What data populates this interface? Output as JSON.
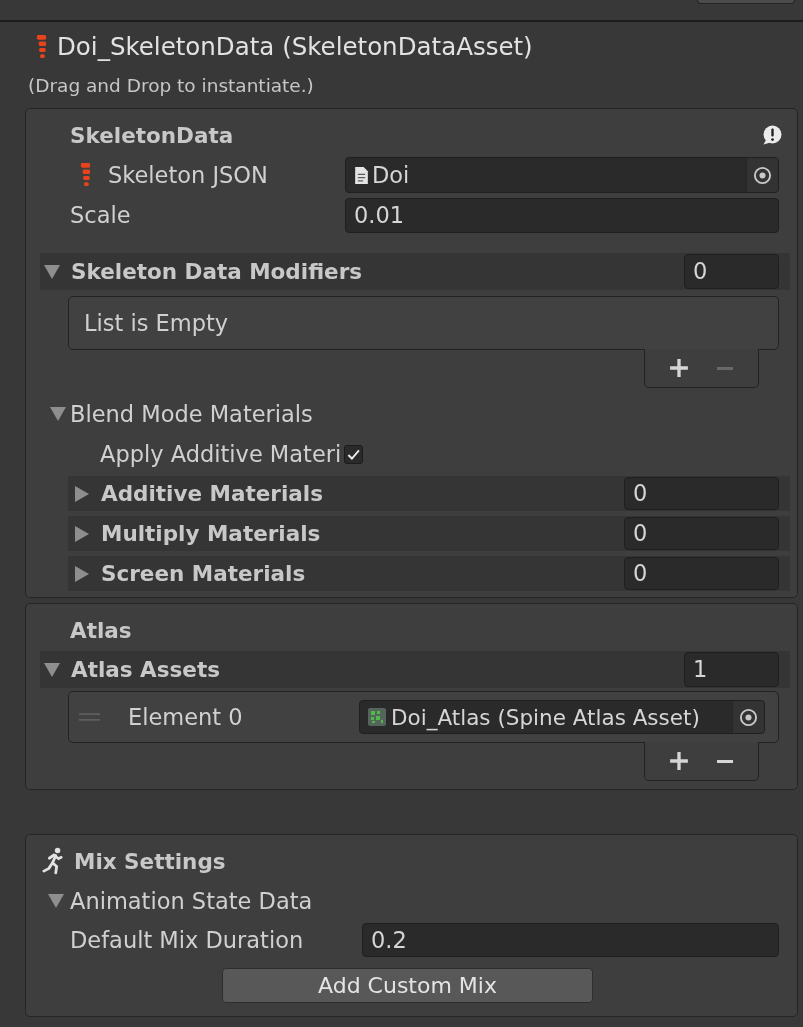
{
  "header": {
    "title": "Doi_SkeletonData (SkeletonDataAsset)",
    "hint": "(Drag and Drop to instantiate.)"
  },
  "skeleton_data": {
    "title": "SkeletonData",
    "skeleton_json": {
      "label": "Skeleton JSON",
      "value": "Doi"
    },
    "scale": {
      "label": "Scale",
      "value": "0.01"
    },
    "modifiers": {
      "label": "Skeleton Data Modifiers",
      "count": "0",
      "expanded": true,
      "empty_text": "List is Empty",
      "remove_disabled": true
    },
    "blend_mode_materials": {
      "label": "Blend Mode Materials",
      "expanded": true,
      "apply_additive": {
        "label": "Apply Additive Materi",
        "checked": true
      },
      "lists": [
        {
          "label": "Additive Materials",
          "count": "0",
          "expanded": false
        },
        {
          "label": "Multiply Materials",
          "count": "0",
          "expanded": false
        },
        {
          "label": "Screen Materials",
          "count": "0",
          "expanded": false
        }
      ]
    }
  },
  "atlas": {
    "title": "Atlas",
    "assets": {
      "label": "Atlas Assets",
      "count": "1",
      "expanded": true,
      "remove_disabled": false,
      "elements": [
        {
          "label": "Element 0",
          "value": "Doi_Atlas (Spine Atlas Asset)"
        }
      ]
    }
  },
  "mix_settings": {
    "title": "Mix Settings",
    "animation_state_data": {
      "label": "Animation State Data",
      "expanded": true,
      "default_mix_duration": {
        "label": "Default Mix Duration",
        "value": "0.2"
      }
    },
    "button": "Add Custom Mix"
  }
}
